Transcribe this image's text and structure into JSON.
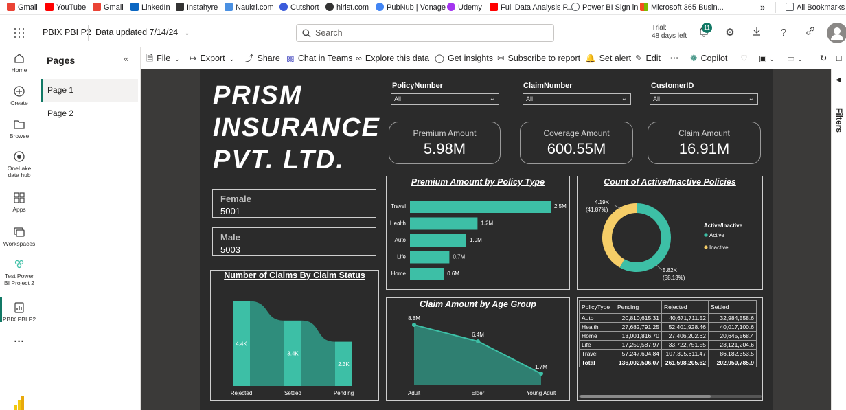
{
  "bookmarks": [
    {
      "label": "Gmail",
      "icon": "gmail-icon",
      "color": "#ea4335"
    },
    {
      "label": "YouTube",
      "icon": "youtube-icon",
      "color": "#ff0000"
    },
    {
      "label": "Gmail",
      "icon": "gmail-icon",
      "color": "#ea4335"
    },
    {
      "label": "LinkedIn",
      "icon": "linkedin-icon",
      "color": "#0a66c2"
    },
    {
      "label": "Instahyre",
      "icon": "instahyre-icon",
      "color": "#333333"
    },
    {
      "label": "Naukri.com",
      "icon": "naukri-icon",
      "color": "#4a90e2"
    },
    {
      "label": "Cutshort",
      "icon": "cutshort-icon",
      "color": "#3b5bdb"
    },
    {
      "label": "hirist.com",
      "icon": "hirist-icon",
      "color": "#333333"
    },
    {
      "label": "PubNub | Vonage",
      "icon": "google-icon",
      "color": "#4285f4"
    },
    {
      "label": "Udemy",
      "icon": "udemy-icon",
      "color": "#a435f0"
    },
    {
      "label": "Full Data Analysis P...",
      "icon": "youtube-icon",
      "color": "#ff0000"
    },
    {
      "label": "Power BI Sign in",
      "icon": "globe-icon",
      "color": "#5f6368"
    },
    {
      "label": "Microsoft 365 Busin...",
      "icon": "microsoft-icon",
      "color": "#f25022"
    }
  ],
  "bookmarks_more": "»",
  "all_bookmarks": "All Bookmarks",
  "header": {
    "report_name": "PBIX PBI P2",
    "data_updated": "Data updated 7/14/24",
    "search_placeholder": "Search",
    "trial_line1": "Trial:",
    "trial_line2": "48 days left",
    "notification_count": "11"
  },
  "leftnav": [
    {
      "label": "Home"
    },
    {
      "label": "Create"
    },
    {
      "label": "Browse"
    },
    {
      "label": "OneLake data hub"
    },
    {
      "label": "Apps"
    },
    {
      "label": "Workspaces"
    },
    {
      "label": "Test Power BI Project 2"
    },
    {
      "label": "PBIX PBI P2"
    }
  ],
  "pages_pane": {
    "title": "Pages",
    "pages": [
      "Page 1",
      "Page 2"
    ]
  },
  "toolbar": {
    "file": "File",
    "export": "Export",
    "share": "Share",
    "chat": "Chat in Teams",
    "explore": "Explore this data",
    "insights": "Get insights",
    "subscribe": "Subscribe to report",
    "alert": "Set alert",
    "edit": "Edit",
    "more": "···",
    "copilot": "Copilot"
  },
  "filters_label": "Filters",
  "report": {
    "title_lines": [
      "PRISM",
      "INSURANCE",
      "PVT. LTD."
    ],
    "gender_boxes": [
      {
        "label": "Female",
        "value": "5001"
      },
      {
        "label": "Male",
        "value": "5003"
      }
    ],
    "slicers": [
      {
        "label": "PolicyNumber",
        "value": "All"
      },
      {
        "label": "ClaimNumber",
        "value": "All"
      },
      {
        "label": "CustomerID",
        "value": "All"
      }
    ],
    "cards": [
      {
        "label": "Premium Amount",
        "value": "5.98M"
      },
      {
        "label": "Coverage Amount",
        "value": "600.55M"
      },
      {
        "label": "Claim Amount",
        "value": "16.91M"
      }
    ],
    "accent_color": "#3dbfa6",
    "inactive_color": "#f5cd67"
  },
  "chart_data": [
    {
      "type": "bar",
      "title": "Premium Amount by Policy Type",
      "categories": [
        "Travel",
        "Health",
        "Auto",
        "Life",
        "Home"
      ],
      "values": [
        2.5,
        1.2,
        1.0,
        0.7,
        0.6
      ],
      "data_labels": [
        "2.5M",
        "1.2M",
        "1.0M",
        "0.7M",
        "0.6M"
      ],
      "unit": "M"
    },
    {
      "type": "pie",
      "title": "Count of Active/Inactive Policies",
      "legend_title": "Active/Inactive",
      "slices": [
        {
          "name": "Active",
          "value": 5.82,
          "label": "5.82K",
          "pct": "(58.13%)"
        },
        {
          "name": "Inactive",
          "value": 4.19,
          "label": "4.19K",
          "pct": "(41.87%)"
        }
      ]
    },
    {
      "type": "area",
      "title": "Number of Claims By Claim Status",
      "categories": [
        "Rejected",
        "Settled",
        "Pending"
      ],
      "values": [
        4.4,
        3.4,
        2.3
      ],
      "data_labels": [
        "4.4K",
        "3.4K",
        "2.3K"
      ]
    },
    {
      "type": "line",
      "title": "Claim Amount by Age Group",
      "categories": [
        "Adult",
        "Elder",
        "Young Adult"
      ],
      "values": [
        8.8,
        6.4,
        1.7
      ],
      "data_labels": [
        "8.8M",
        "6.4M",
        "1.7M"
      ]
    },
    {
      "type": "table",
      "columns": [
        "PolicyType",
        "Pending",
        "Rejected",
        "Settled"
      ],
      "rows": [
        [
          "Auto",
          "20,810,615.31",
          "40,671,711.52",
          "32,984,558.6"
        ],
        [
          "Health",
          "27,682,791.25",
          "52,401,928.46",
          "40,017,100.6"
        ],
        [
          "Home",
          "13,001,816.70",
          "27,406,202.62",
          "20,645,568.4"
        ],
        [
          "Life",
          "17,259,587.97",
          "33,722,751.55",
          "23,121,204.6"
        ],
        [
          "Travel",
          "57,247,694.84",
          "107,395,611.47",
          "86,182,353.5"
        ],
        [
          "Total",
          "136,002,506.07",
          "261,598,205.62",
          "202,950,785.9"
        ]
      ]
    }
  ]
}
